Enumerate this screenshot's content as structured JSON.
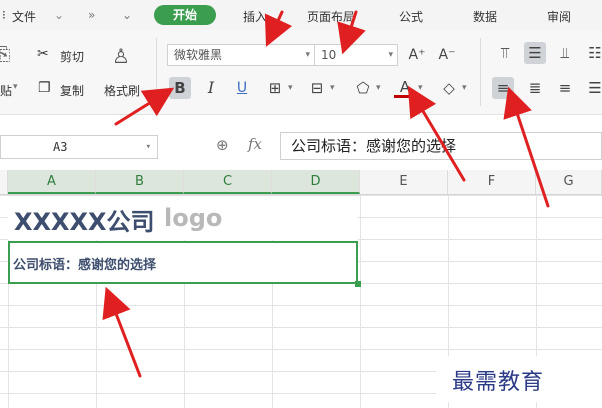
{
  "menubar": {
    "file": "文件",
    "more": "»",
    "items": [
      "开始",
      "插入",
      "页面布局",
      "公式",
      "数据",
      "审阅"
    ]
  },
  "clipboard": {
    "cut": "剪切",
    "copy": "复制",
    "paste_partial": "贴",
    "format_painter": "格式刷"
  },
  "font": {
    "family": "微软雅黑",
    "size": "10",
    "bold": "B",
    "italic": "I",
    "underline": "U",
    "font_color_letter": "A",
    "grow": "A⁺",
    "shrink": "A⁻"
  },
  "formula_bar": {
    "cell_ref": "A3",
    "fx": "fx",
    "content": "公司标语：感谢您的选择"
  },
  "columns": [
    "A",
    "B",
    "C",
    "D",
    "E",
    "F",
    "G"
  ],
  "sheet": {
    "company_name": "XXXXX公司",
    "company_logo": "logo",
    "slogan": "公司标语：感谢您的选择"
  },
  "watermark": "最需教育",
  "colors": {
    "accent": "#3a9e4e",
    "text_blue": "#3d4e6e",
    "arrow": "#e02020",
    "font_color_underline": "#c00000"
  }
}
